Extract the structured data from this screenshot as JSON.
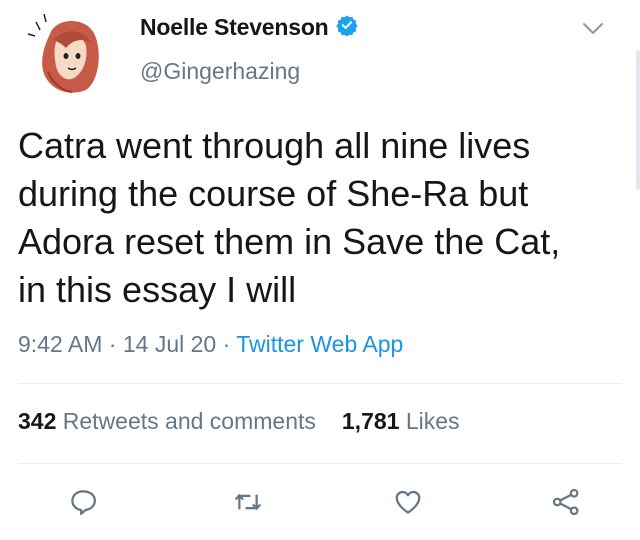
{
  "author": {
    "name": "Noelle Stevenson",
    "handle": "@Gingerhazing",
    "verified": true
  },
  "tweet": {
    "text": "Catra went through all nine lives\nduring the course of She-Ra but\nAdora reset them in Save the Cat,\nin this essay I will",
    "time": "9:42 AM",
    "date": "14 Jul 20",
    "source": "Twitter Web App"
  },
  "stats": {
    "retweets_count": "342",
    "retweets_label": "Retweets and comments",
    "likes_count": "1,781",
    "likes_label": "Likes"
  },
  "icons": {
    "verified": "verified-badge-icon",
    "caret": "chevron-down-icon",
    "reply": "reply-icon",
    "retweet": "retweet-icon",
    "like": "heart-icon",
    "share": "share-icon"
  },
  "colors": {
    "text": "#14171a",
    "muted": "#657786",
    "link": "#1b95e0",
    "verified": "#1da1f2"
  }
}
